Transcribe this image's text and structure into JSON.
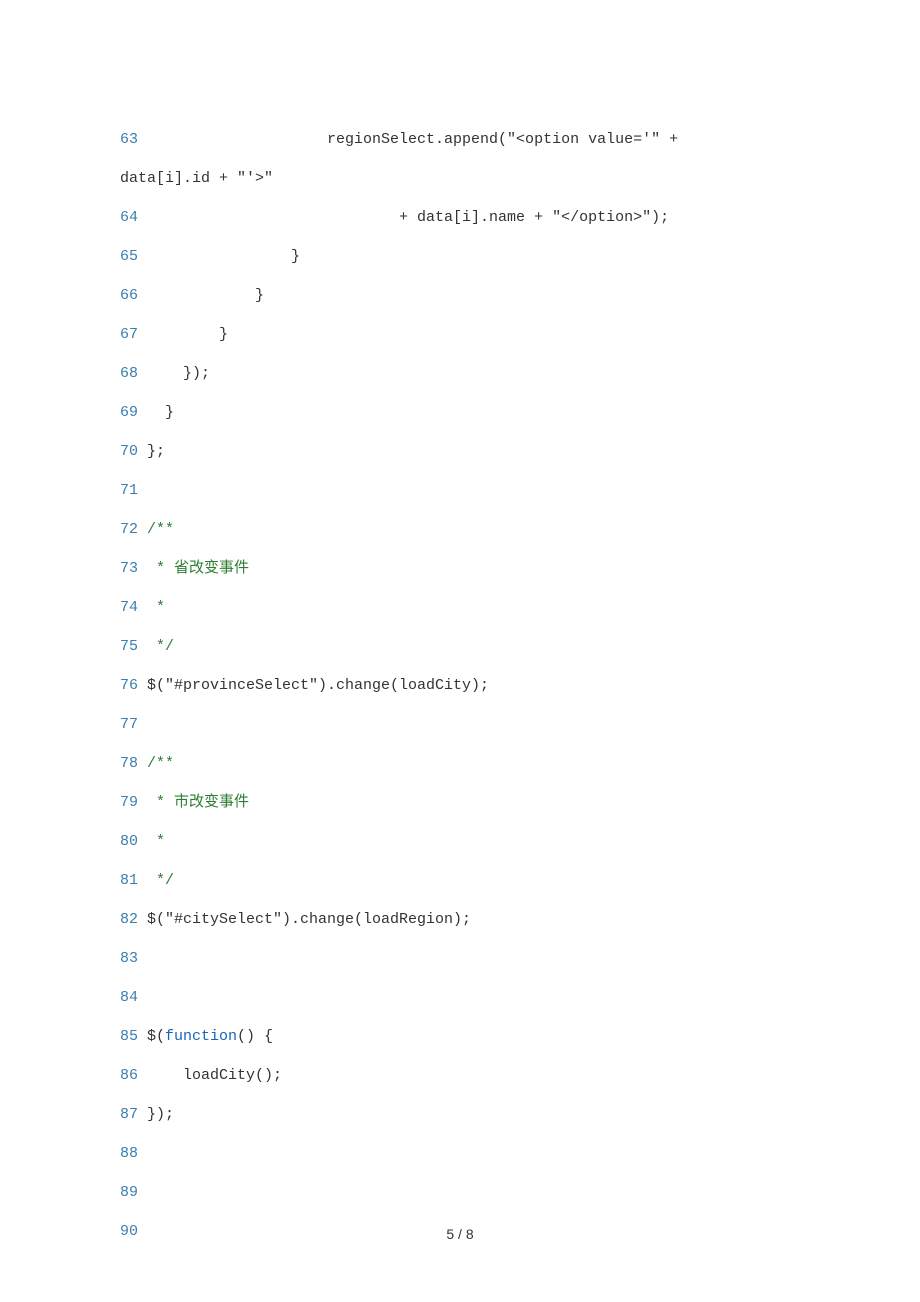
{
  "lines": [
    {
      "num": "63",
      "segments": [
        {
          "cls": "plain",
          "text": "                    regionSelect.append(\"<option value='\" + "
        }
      ]
    },
    {
      "num": "",
      "segments": [
        {
          "cls": "plain",
          "text": "data[i].id + \"'>\""
        }
      ],
      "wrap": true
    },
    {
      "num": "64",
      "segments": [
        {
          "cls": "plain",
          "text": "                            + data[i].name + \"</option>\");"
        }
      ]
    },
    {
      "num": "65",
      "segments": [
        {
          "cls": "plain",
          "text": "                }"
        }
      ]
    },
    {
      "num": "66",
      "segments": [
        {
          "cls": "plain",
          "text": "            }"
        }
      ]
    },
    {
      "num": "67",
      "segments": [
        {
          "cls": "plain",
          "text": "        }"
        }
      ]
    },
    {
      "num": "68",
      "segments": [
        {
          "cls": "plain",
          "text": "    });"
        }
      ]
    },
    {
      "num": "69",
      "segments": [
        {
          "cls": "plain",
          "text": "  }"
        }
      ]
    },
    {
      "num": "70",
      "segments": [
        {
          "cls": "plain",
          "text": "};"
        }
      ]
    },
    {
      "num": "71",
      "segments": [
        {
          "cls": "plain",
          "text": ""
        }
      ]
    },
    {
      "num": "72",
      "segments": [
        {
          "cls": "comment",
          "text": "/**"
        }
      ]
    },
    {
      "num": "73",
      "segments": [
        {
          "cls": "comment",
          "text": " * 省改变事件"
        }
      ]
    },
    {
      "num": "74",
      "segments": [
        {
          "cls": "comment",
          "text": " * "
        }
      ]
    },
    {
      "num": "75",
      "segments": [
        {
          "cls": "comment",
          "text": " */"
        }
      ]
    },
    {
      "num": "76",
      "segments": [
        {
          "cls": "plain",
          "text": "$(\"#provinceSelect\").change(loadCity);"
        }
      ]
    },
    {
      "num": "77",
      "segments": [
        {
          "cls": "plain",
          "text": ""
        }
      ]
    },
    {
      "num": "78",
      "segments": [
        {
          "cls": "comment",
          "text": "/**"
        }
      ]
    },
    {
      "num": "79",
      "segments": [
        {
          "cls": "comment",
          "text": " * 市改变事件"
        }
      ]
    },
    {
      "num": "80",
      "segments": [
        {
          "cls": "comment",
          "text": " * "
        }
      ]
    },
    {
      "num": "81",
      "segments": [
        {
          "cls": "comment",
          "text": " */"
        }
      ]
    },
    {
      "num": "82",
      "segments": [
        {
          "cls": "plain",
          "text": "$(\"#citySelect\").change(loadRegion);"
        }
      ]
    },
    {
      "num": "83",
      "segments": [
        {
          "cls": "plain",
          "text": ""
        }
      ]
    },
    {
      "num": "84",
      "segments": [
        {
          "cls": "plain",
          "text": ""
        }
      ]
    },
    {
      "num": "85",
      "segments": [
        {
          "cls": "plain",
          "text": "$("
        },
        {
          "cls": "keyword",
          "text": "function"
        },
        {
          "cls": "plain",
          "text": "() {"
        }
      ]
    },
    {
      "num": "86",
      "segments": [
        {
          "cls": "plain",
          "text": "    loadCity();"
        }
      ]
    },
    {
      "num": "87",
      "segments": [
        {
          "cls": "plain",
          "text": "});"
        }
      ]
    },
    {
      "num": "88",
      "segments": [
        {
          "cls": "plain",
          "text": ""
        }
      ]
    },
    {
      "num": "89",
      "segments": [
        {
          "cls": "plain",
          "text": ""
        }
      ]
    },
    {
      "num": "90",
      "segments": [
        {
          "cls": "plain",
          "text": ""
        }
      ]
    }
  ],
  "footer": "5 / 8"
}
